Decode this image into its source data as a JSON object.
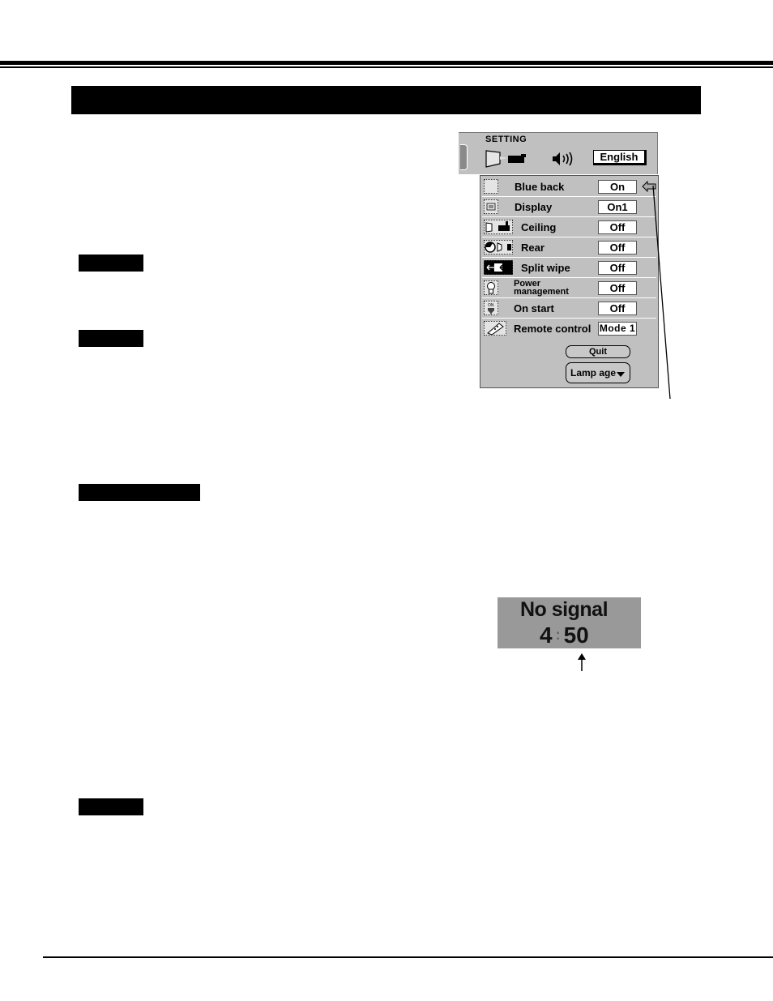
{
  "page": {
    "section_title": "",
    "labels": [
      "",
      "",
      "",
      ""
    ]
  },
  "osd": {
    "menu_title": "SETTING",
    "language_button": "English",
    "icons": {
      "screen_projector": "screen-projector-icon",
      "sound": "speaker-icon"
    },
    "items": [
      {
        "label": "Blue back",
        "value": "On",
        "icon": "blank-screen-icon",
        "pointer": true
      },
      {
        "label": "Display",
        "value": "On1",
        "icon": "display-icon"
      },
      {
        "label": "Ceiling",
        "value": "Off",
        "icon": "ceiling-projector-icon"
      },
      {
        "label": "Rear",
        "value": "Off",
        "icon": "rear-projection-icon"
      },
      {
        "label": "Split wipe",
        "value": "Off",
        "icon": "split-wipe-icon"
      },
      {
        "label_line1": "Power",
        "label_line2": "management",
        "value": "Off",
        "icon": "lightbulb-icon"
      },
      {
        "label": "On start",
        "value": "Off",
        "icon": "power-plug-icon"
      },
      {
        "label": "Remote control",
        "value": "Mode 1",
        "icon": "remote-control-icon"
      }
    ],
    "quit_button": "Quit",
    "lamp_age_button": "Lamp age"
  },
  "no_signal_display": {
    "message": "No signal",
    "minutes": "4",
    "separator": ":",
    "seconds": "50"
  }
}
